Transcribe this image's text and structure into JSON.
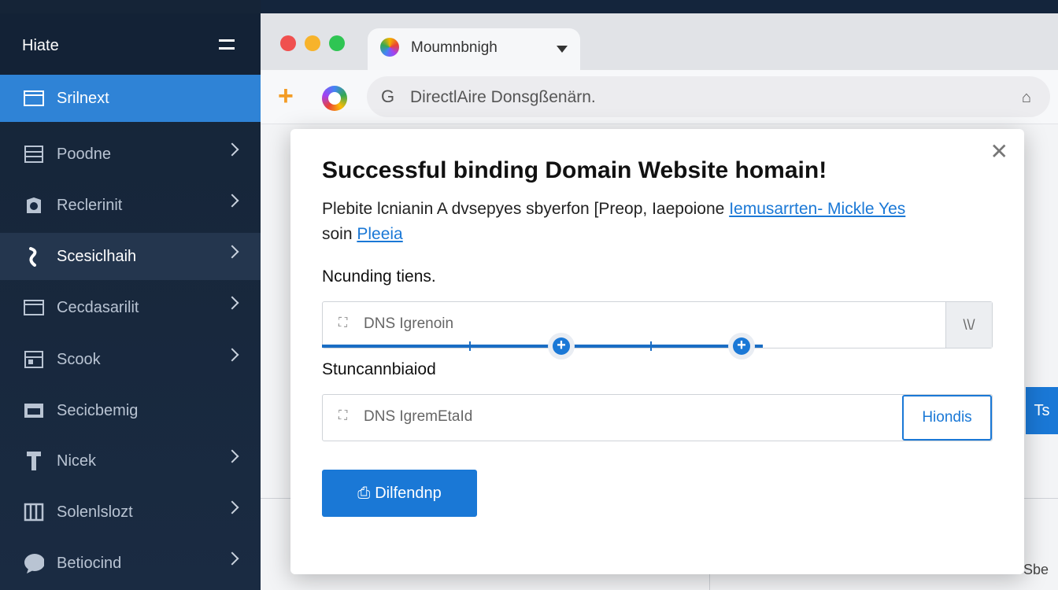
{
  "sidebar": {
    "title": "Hiate",
    "items": [
      {
        "label": "Srilnext",
        "icon": "browser-window-icon",
        "state": "active",
        "chevron": false
      },
      {
        "label": "Poodne",
        "icon": "server-icon",
        "state": "normal",
        "chevron": true
      },
      {
        "label": "Reclerinit",
        "icon": "shield-icon",
        "state": "normal",
        "chevron": true
      },
      {
        "label": "Scesiclhaih",
        "icon": "tool-icon",
        "state": "hover",
        "chevron": true
      },
      {
        "label": "Cecdasarilit",
        "icon": "window-icon",
        "state": "normal",
        "chevron": true
      },
      {
        "label": "Scook",
        "icon": "storage-icon",
        "state": "normal",
        "chevron": true
      },
      {
        "label": "Secicbemig",
        "icon": "panel-icon",
        "state": "normal",
        "chevron": false
      },
      {
        "label": "Nicek",
        "icon": "wrench-icon",
        "state": "normal",
        "chevron": true
      },
      {
        "label": "Solenlslozt",
        "icon": "columns-icon",
        "state": "normal",
        "chevron": true
      },
      {
        "label": "Betiocind",
        "icon": "chat-bubble-icon",
        "state": "normal",
        "chevron": true
      }
    ]
  },
  "browser": {
    "tab_title": "Moumnbnigh",
    "omnibox_prefix": "G",
    "omnibox_text": "DirectlAire Donsgßenärn.",
    "toolbar_plus": "+",
    "home_glyph": "⌂",
    "side_button_label": "Ts",
    "footer_text": "Sbe"
  },
  "modal": {
    "close_glyph": "✕",
    "title": "Successful binding Domain Website homain!",
    "desc_text": "Plebite lcnianin A dvsepyes sbyerfon [Preop, Iaepoione ",
    "desc_link1": "Iemusarrten- Mickle Yes",
    "desc_text2": "soin ",
    "desc_link2": "Pleeia",
    "label1": "Ncunding tiens.",
    "field1_placeholder": "DNS Igrenoin",
    "field1_dropdown": "\\\\/",
    "label2": "Stuncannbiaiod",
    "field2_placeholder": "DNS IgremEtaId",
    "field2_button": "Hiondis",
    "primary_button": "Dilfendnp",
    "primary_button_icon": "⎙"
  },
  "colors": {
    "accent": "#1a78d6",
    "sidebar_bg": "#1a2b42",
    "sidebar_active": "#2f83d6",
    "traffic_red": "#f0504f",
    "traffic_yellow": "#f7b32b",
    "traffic_green": "#2fc553"
  }
}
